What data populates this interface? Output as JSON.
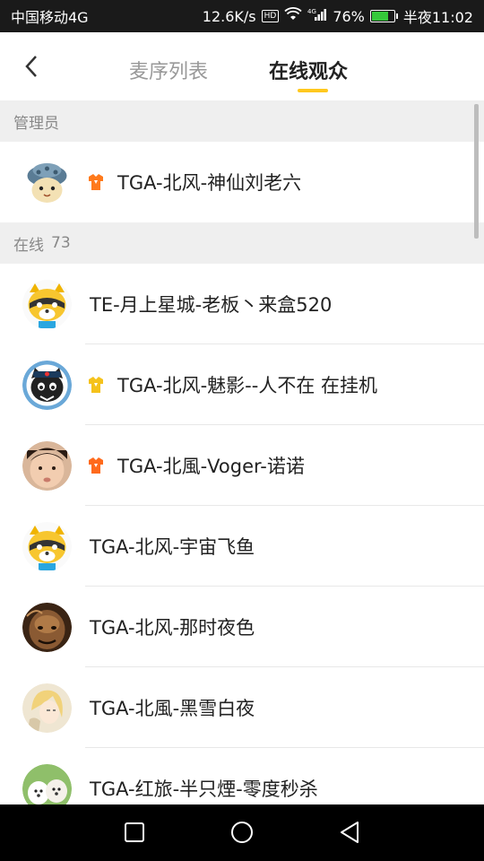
{
  "status_bar": {
    "carrier": "中国移动4G",
    "speed": "12.6K/s",
    "hd": "HD",
    "battery_percent": "76%",
    "battery_level": 0.76,
    "time": "半夜11:02"
  },
  "header": {
    "tabs": [
      {
        "label": "麦序列表",
        "active": false
      },
      {
        "label": "在线观众",
        "active": true
      }
    ],
    "accent_color": "#ffc81e"
  },
  "sections": {
    "admin": {
      "label": "管理员"
    },
    "online": {
      "label": "在线",
      "count": "73"
    }
  },
  "admins": [
    {
      "name": "TGA-北风-神仙刘老六",
      "badge": "orange-shirt-icon",
      "avatar": "helmet-avatar"
    }
  ],
  "online_users": [
    {
      "name": "TE-月上星城-老板丶来盒520",
      "badge": null,
      "avatar": "raccoon-avatar"
    },
    {
      "name": "TGA-北风-魅影--人不在 在挂机",
      "badge": "yellow-shirt-icon",
      "avatar": "black-cat-avatar"
    },
    {
      "name": "TGA-北風-Voger-诺诺",
      "badge": "orange-shirt-icon",
      "avatar": "child-photo-avatar"
    },
    {
      "name": "TGA-北风-宇宙飞鱼",
      "badge": null,
      "avatar": "raccoon-avatar"
    },
    {
      "name": "TGA-北风-那时夜色",
      "badge": null,
      "avatar": "monster-avatar"
    },
    {
      "name": "TGA-北風-黑雪白夜",
      "badge": null,
      "avatar": "anime-girl-avatar"
    },
    {
      "name": "TGA-红旅-半只煙-零度秒杀",
      "badge": null,
      "avatar": "puppies-avatar"
    }
  ]
}
